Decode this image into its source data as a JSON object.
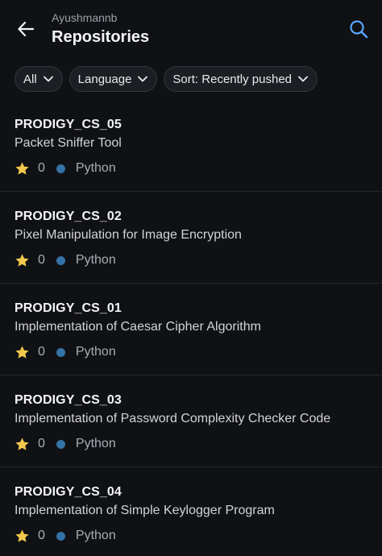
{
  "header": {
    "owner": "Ayushmannb",
    "title": "Repositories"
  },
  "filters": [
    {
      "label": "All"
    },
    {
      "label": "Language"
    },
    {
      "label": "Sort: Recently pushed"
    }
  ],
  "colors": {
    "background": "#101114",
    "accent": "#58a6ff",
    "star": "#f2c94c",
    "python": "#3572a5"
  },
  "repos": [
    {
      "name": "PRODIGY_CS_05",
      "description": "Packet Sniffer Tool",
      "stars": "0",
      "language": "Python"
    },
    {
      "name": "PRODIGY_CS_02",
      "description": "Pixel Manipulation for Image Encryption",
      "stars": "0",
      "language": "Python"
    },
    {
      "name": "PRODIGY_CS_01",
      "description": "Implementation of Caesar Cipher Algorithm",
      "stars": "0",
      "language": "Python"
    },
    {
      "name": "PRODIGY_CS_03",
      "description": "Implementation of Password Complexity Checker Code",
      "stars": "0",
      "language": "Python"
    },
    {
      "name": "PRODIGY_CS_04",
      "description": "Implementation of Simple Keylogger Program",
      "stars": "0",
      "language": "Python"
    }
  ]
}
